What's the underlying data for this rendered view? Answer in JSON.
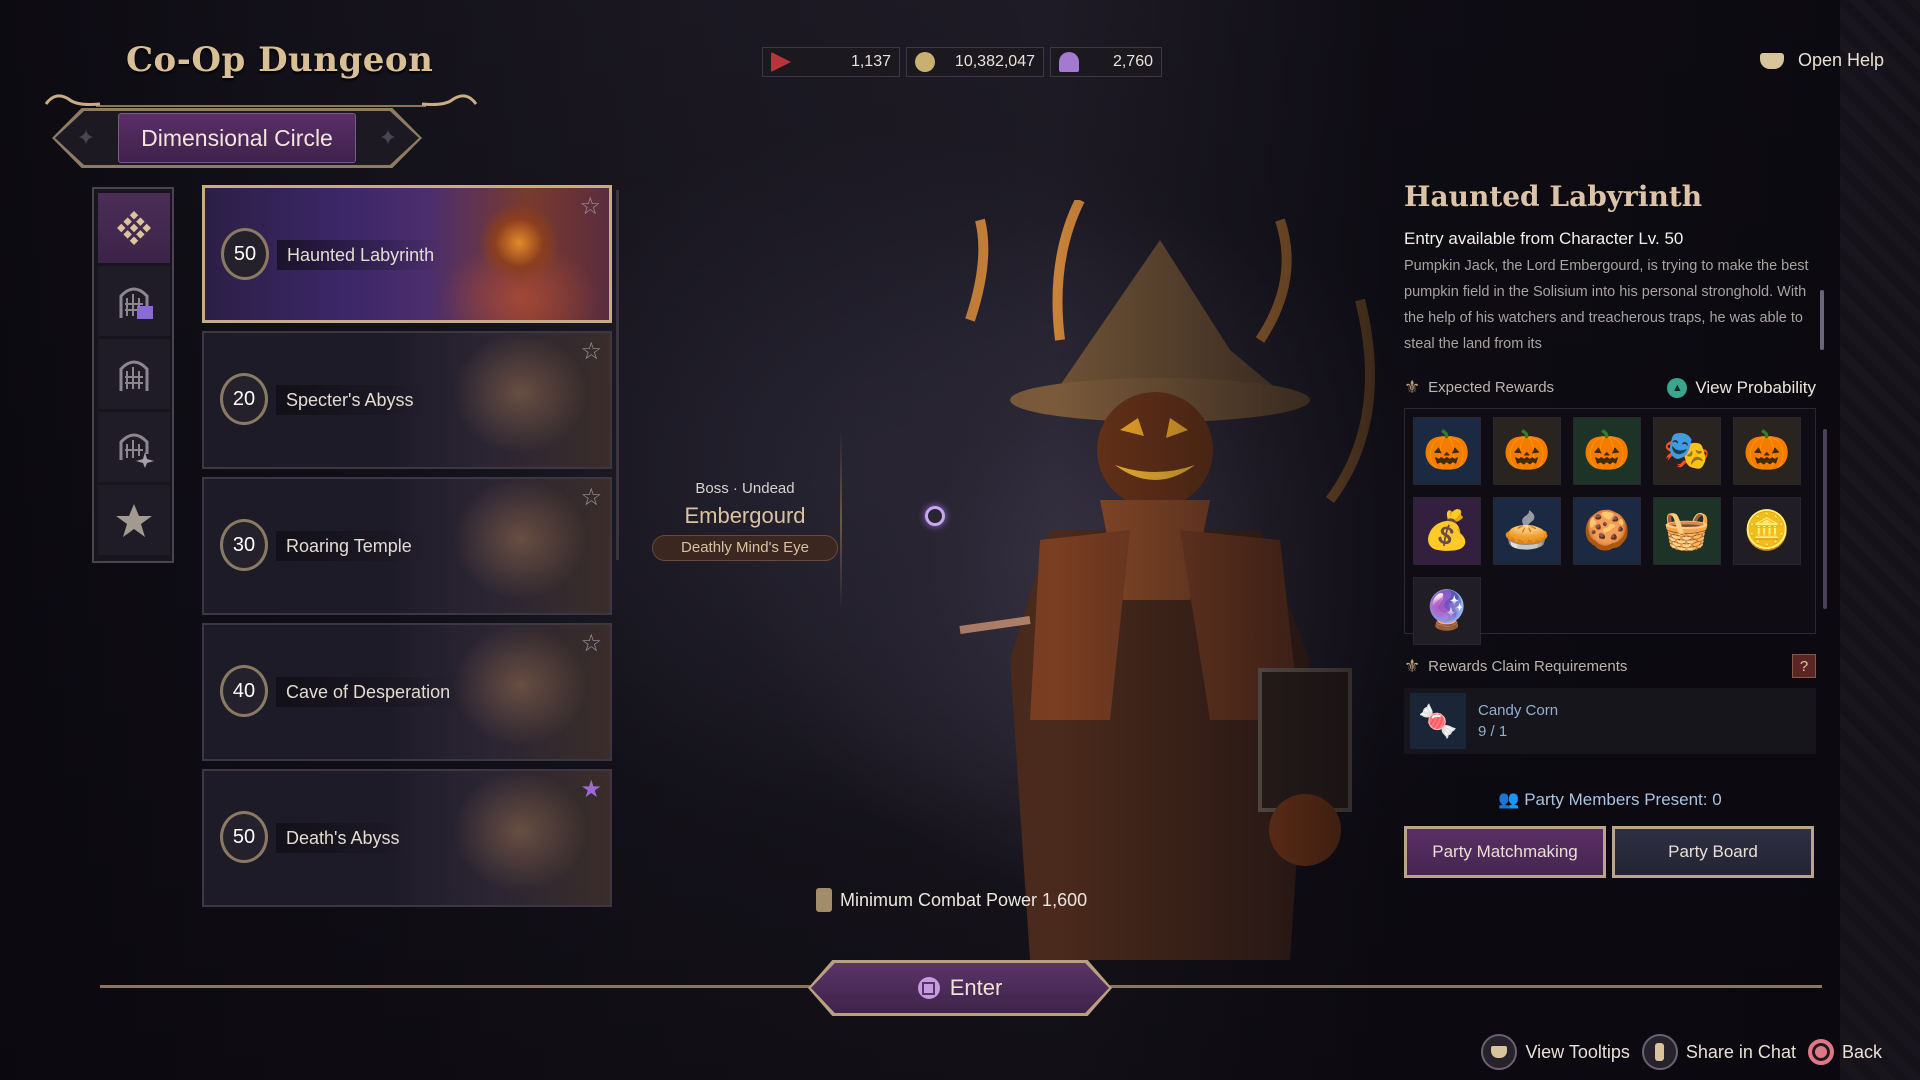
{
  "header": {
    "title": "Co-Op Dungeon",
    "subtab": "Dimensional Circle",
    "help_label": "Open Help"
  },
  "currencies": [
    {
      "icon": "red-gem-icon",
      "value": "1,137",
      "color": "#b6343a"
    },
    {
      "icon": "gold-coin-icon",
      "value": "10,382,047",
      "color": "#c8b070"
    },
    {
      "icon": "hooded-figure-icon",
      "value": "2,760",
      "color": "#a47ad0"
    }
  ],
  "sidebar": {
    "items": [
      {
        "icon": "grid-diamond-icon",
        "active": true
      },
      {
        "icon": "gate-calendar-icon",
        "active": false
      },
      {
        "icon": "gate-icon",
        "active": false
      },
      {
        "icon": "gate-sparkle-icon",
        "active": false
      },
      {
        "icon": "star-icon",
        "active": false
      }
    ]
  },
  "dungeons": [
    {
      "level": "50",
      "name": "Haunted Labyrinth",
      "selected": true,
      "favorite": false
    },
    {
      "level": "20",
      "name": "Specter's Abyss",
      "selected": false,
      "favorite": false
    },
    {
      "level": "30",
      "name": "Roaring Temple",
      "selected": false,
      "favorite": false
    },
    {
      "level": "40",
      "name": "Cave of Desperation",
      "selected": false,
      "favorite": false
    },
    {
      "level": "50",
      "name": "Death's Abyss",
      "selected": false,
      "favorite": true
    }
  ],
  "boss": {
    "type": "Boss · Undead",
    "name": "Embergourd",
    "trait": "Deathly Mind's Eye"
  },
  "combat_power": {
    "label": "Minimum Combat Power 1,600"
  },
  "enter_label": "Enter",
  "details": {
    "name": "Haunted Labyrinth",
    "entry": "Entry available from Character Lv. 50",
    "description": "Pumpkin Jack, the Lord Embergourd, is trying to make the best pumpkin field in the Solisium into his personal stronghold. With the help of his watchers and treacherous traps, he was able to steal the land from its",
    "rewards_heading": "Expected Rewards",
    "view_probability": "View Probability",
    "rewards": [
      {
        "icon": "jack-o-lantern-icon",
        "glyph": "🎃",
        "bg": "blue"
      },
      {
        "icon": "carved-pumpkin-icon",
        "glyph": "🎃",
        "bg": "brown"
      },
      {
        "icon": "pumpkin-house-icon",
        "glyph": "🎃",
        "bg": "green"
      },
      {
        "icon": "plague-mask-icon",
        "glyph": "🎭",
        "bg": "brown"
      },
      {
        "icon": "angry-pumpkin-icon",
        "glyph": "🎃",
        "bg": "brown"
      },
      {
        "icon": "gift-sack-icon",
        "glyph": "💰",
        "bg": "purple"
      },
      {
        "icon": "pumpkin-pie-icon",
        "glyph": "🥧",
        "bg": "blue"
      },
      {
        "icon": "spider-pie-icon",
        "glyph": "🍪",
        "bg": "blue"
      },
      {
        "icon": "fruit-basket-icon",
        "glyph": "🧺",
        "bg": "green"
      },
      {
        "icon": "treasure-chest-icon",
        "glyph": "🪙",
        "bg": "dark"
      },
      {
        "icon": "pink-token-icon",
        "glyph": "🔮",
        "bg": "dark"
      }
    ],
    "requirements_heading": "Rewards Claim Requirements",
    "requirement": {
      "name": "Candy Corn",
      "count": "9 / 1",
      "glyph": "🍬"
    },
    "party_present": "Party Members Present:  0",
    "matchmaking_label": "Party Matchmaking",
    "board_label": "Party Board"
  },
  "footer": {
    "tooltips": "View Tooltips",
    "share": "Share in Chat",
    "back": "Back"
  }
}
